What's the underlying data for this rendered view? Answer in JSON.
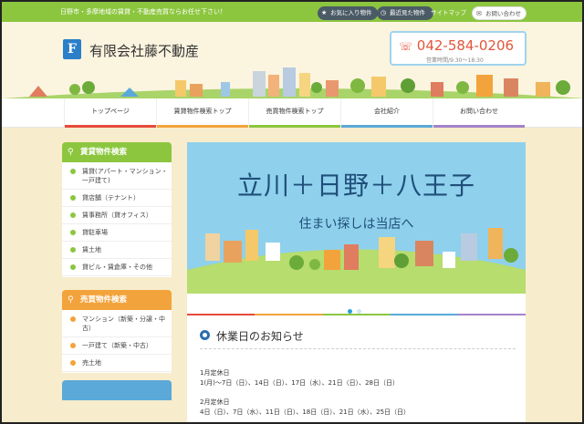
{
  "topbar": {
    "tagline": "日野市・多摩地域の賃貸・不動産売買ならお任せ下さい！",
    "favorites": "お気に入り物件",
    "recent": "最近見た物件",
    "sitemap": "サイトマップ",
    "contact": "お問い合わせ"
  },
  "header": {
    "logo_letter": "F",
    "company": "有限会社藤不動産",
    "phone": "042-584-0206",
    "hours": "営業時間/9:30〜18:30"
  },
  "nav": {
    "items": [
      {
        "label": "トップページ",
        "color": "#e64a3b"
      },
      {
        "label": "賃貸物件検索トップ",
        "color": "#f3a33b"
      },
      {
        "label": "売買物件検索トップ",
        "color": "#8cc63f"
      },
      {
        "label": "会社紹介",
        "color": "#5aa9d9"
      },
      {
        "label": "お問い合わせ",
        "color": "#a582c8"
      }
    ]
  },
  "sidebar": {
    "rent_head": "賃貸物件検索",
    "rent_items": [
      "賃貸(アパート・マンション・一戸建て)",
      "貸店舗（テナント）",
      "賃事務所（貸オフィス）",
      "貸駐車場",
      "賃土地",
      "貸ビル・賃倉庫・その他"
    ],
    "sale_head": "売買物件検索",
    "sale_items": [
      "マンション（新築・分譲・中古）",
      "一戸建て（新築・中古）",
      "売土地"
    ]
  },
  "hero": {
    "title": "立川＋日野＋八王子",
    "subtitle": "住まい探しは当店へ"
  },
  "notice": {
    "title": "休業日のお知らせ",
    "jan_head": "1月定休日",
    "jan_days": "1(月)〜7日（日）、14日（日）、17日（水）、21日（日）、28日（日）",
    "feb_head": "2月定休日",
    "feb_days": "4日（日）、7日（水）、11日（日）、18日（日）、21日（水）、25日（日）"
  }
}
